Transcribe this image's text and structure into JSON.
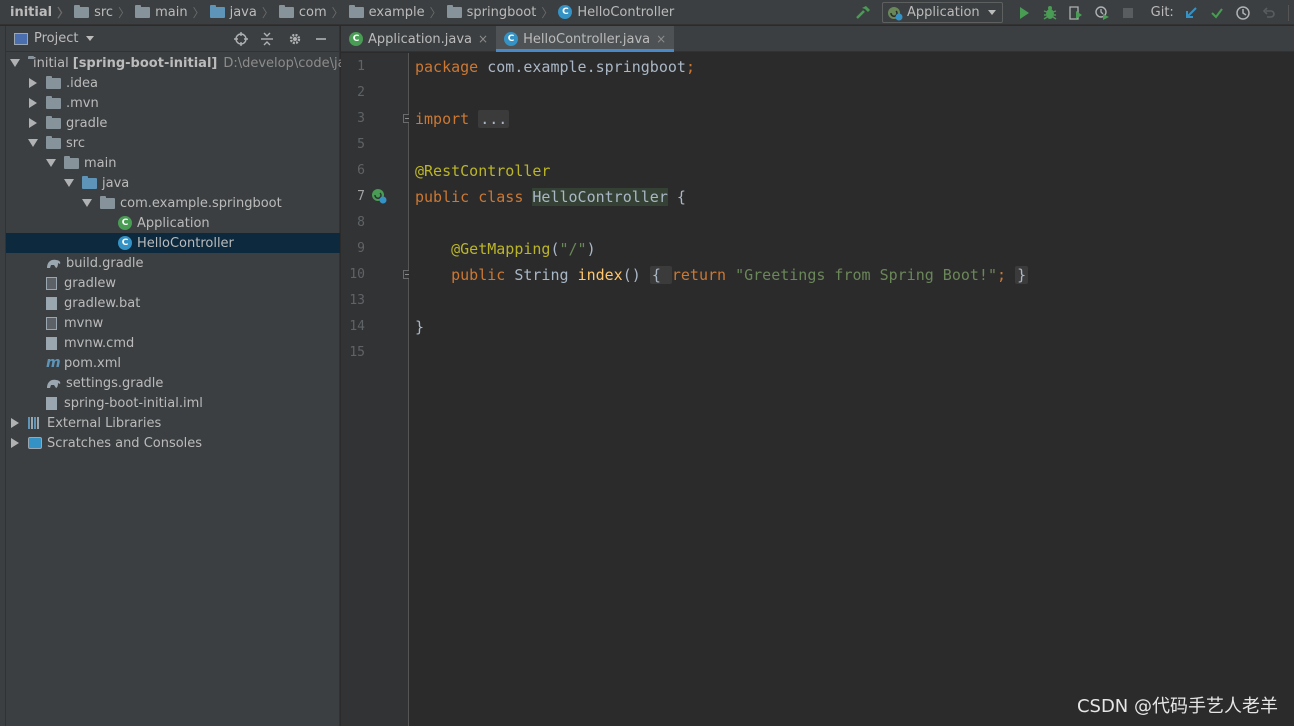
{
  "navbar": {
    "breadcrumbs": [
      "initial",
      "src",
      "main",
      "java",
      "com",
      "example",
      "springboot",
      "HelloController"
    ]
  },
  "toolbar": {
    "run_config": "Application",
    "git_label": "Git:"
  },
  "project_panel": {
    "title": "Project",
    "tree": [
      {
        "label": "initial",
        "bold_label": "[spring-boot-initial]",
        "hint": "D:\\develop\\code\\java\\",
        "depth": 0,
        "toggle": "open",
        "icon": "module-folder-icon"
      },
      {
        "label": ".idea",
        "depth": 1,
        "toggle": "closed",
        "icon": "folder-icon"
      },
      {
        "label": ".mvn",
        "depth": 1,
        "toggle": "closed",
        "icon": "folder-icon"
      },
      {
        "label": "gradle",
        "depth": 1,
        "toggle": "closed",
        "icon": "folder-icon"
      },
      {
        "label": "src",
        "depth": 1,
        "toggle": "open",
        "icon": "folder-icon"
      },
      {
        "label": "main",
        "depth": 2,
        "toggle": "open",
        "icon": "folder-icon"
      },
      {
        "label": "java",
        "depth": 3,
        "toggle": "open",
        "icon": "source-folder-icon"
      },
      {
        "label": "com.example.springboot",
        "depth": 4,
        "toggle": "open",
        "icon": "package-icon"
      },
      {
        "label": "Application",
        "depth": 5,
        "toggle": "none",
        "icon": "spring-boot-class-icon"
      },
      {
        "label": "HelloController",
        "depth": 5,
        "toggle": "none",
        "icon": "class-icon",
        "selected": true
      },
      {
        "label": "build.gradle",
        "depth": 1,
        "toggle": "none",
        "icon": "gradle-icon"
      },
      {
        "label": "gradlew",
        "depth": 1,
        "toggle": "none",
        "icon": "terminal-file-icon"
      },
      {
        "label": "gradlew.bat",
        "depth": 1,
        "toggle": "none",
        "icon": "file-icon"
      },
      {
        "label": "mvnw",
        "depth": 1,
        "toggle": "none",
        "icon": "terminal-file-icon"
      },
      {
        "label": "mvnw.cmd",
        "depth": 1,
        "toggle": "none",
        "icon": "file-icon"
      },
      {
        "label": "pom.xml",
        "depth": 1,
        "toggle": "none",
        "icon": "maven-icon"
      },
      {
        "label": "settings.gradle",
        "depth": 1,
        "toggle": "none",
        "icon": "gradle-icon"
      },
      {
        "label": "spring-boot-initial.iml",
        "depth": 1,
        "toggle": "none",
        "icon": "iml-file-icon"
      },
      {
        "label": "External Libraries",
        "depth": 0,
        "toggle": "closed",
        "icon": "libraries-icon"
      },
      {
        "label": "Scratches and Consoles",
        "depth": 0,
        "toggle": "closed",
        "icon": "scratches-icon"
      }
    ]
  },
  "tabs": [
    {
      "label": "Application.java",
      "active": false
    },
    {
      "label": "HelloController.java",
      "active": true
    }
  ],
  "editor": {
    "line_numbers": [
      "1",
      "2",
      "3",
      "5",
      "6",
      "7",
      "8",
      "9",
      "10",
      "13",
      "14",
      "15"
    ],
    "current_line": "7",
    "code": {
      "l1_kw": "package",
      "l1_rest": " com.example.springboot",
      "l1_semi": ";",
      "l3_kw": "import",
      "l3_fold": "...",
      "l6_ann": "@RestController",
      "l7_kw1": "public",
      "l7_kw2": "class",
      "l7_cls": "HelloController",
      "l7_brace": " {",
      "l9_ann": "@GetMapping",
      "l9_open": "(",
      "l9_str": "\"/\"",
      "l9_close": ")",
      "l10_kw1": "public",
      "l10_type": " String ",
      "l10_fn": "index",
      "l10_parens": "()",
      "l10_fold_open": "{ ",
      "l10_kw2": "return",
      "l10_str": "\"Greetings from Spring Boot!\"",
      "l10_semi": ";",
      "l10_fold_close": "}",
      "l14_brace": "}"
    }
  },
  "watermark": "CSDN @代码手艺人老羊"
}
